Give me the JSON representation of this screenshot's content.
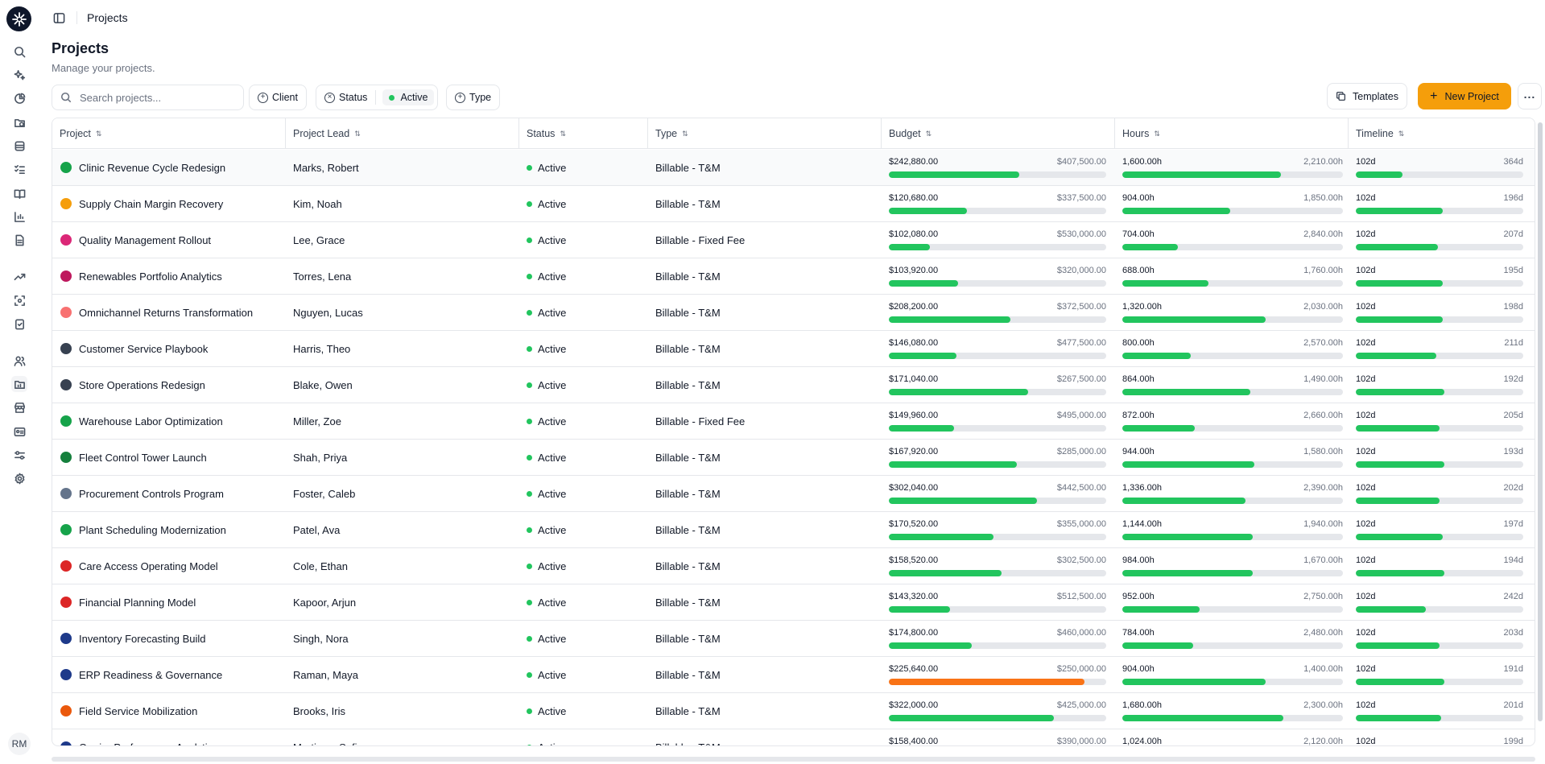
{
  "header": {
    "breadcrumb": "Projects"
  },
  "page": {
    "title": "Projects",
    "subtitle": "Manage your projects."
  },
  "toolbar": {
    "search_placeholder": "Search projects...",
    "client_label": "Client",
    "status_label": "Status",
    "status_value": "Active",
    "type_label": "Type",
    "templates_label": "Templates",
    "new_project_label": "New Project"
  },
  "user": {
    "initials": "RM"
  },
  "columns": {
    "project": "Project",
    "lead": "Project Lead",
    "status": "Status",
    "type": "Type",
    "budget": "Budget",
    "hours": "Hours",
    "timeline": "Timeline"
  },
  "rows": [
    {
      "name": "Clinic Revenue Cycle Redesign",
      "lead": "Marks, Robert",
      "status": "Active",
      "type": "Billable - T&M",
      "budget_used": "$242,880.00",
      "budget_total": "$407,500.00",
      "budget_pct": 60,
      "hours_used": "1,600.00h",
      "hours_total": "2,210.00h",
      "hours_pct": 72,
      "time_used": "102d",
      "time_total": "364d",
      "time_pct": 28,
      "icon_color": "#16a34a"
    },
    {
      "name": "Supply Chain Margin Recovery",
      "lead": "Kim, Noah",
      "status": "Active",
      "type": "Billable - T&M",
      "budget_used": "$120,680.00",
      "budget_total": "$337,500.00",
      "budget_pct": 36,
      "hours_used": "904.00h",
      "hours_total": "1,850.00h",
      "hours_pct": 49,
      "time_used": "102d",
      "time_total": "196d",
      "time_pct": 52,
      "icon_color": "#f59e0b"
    },
    {
      "name": "Quality Management Rollout",
      "lead": "Lee, Grace",
      "status": "Active",
      "type": "Billable - Fixed Fee",
      "budget_used": "$102,080.00",
      "budget_total": "$530,000.00",
      "budget_pct": 19,
      "hours_used": "704.00h",
      "hours_total": "2,840.00h",
      "hours_pct": 25,
      "time_used": "102d",
      "time_total": "207d",
      "time_pct": 49,
      "icon_color": "#db2777"
    },
    {
      "name": "Renewables Portfolio Analytics",
      "lead": "Torres, Lena",
      "status": "Active",
      "type": "Billable - T&M",
      "budget_used": "$103,920.00",
      "budget_total": "$320,000.00",
      "budget_pct": 32,
      "hours_used": "688.00h",
      "hours_total": "1,760.00h",
      "hours_pct": 39,
      "time_used": "102d",
      "time_total": "195d",
      "time_pct": 52,
      "icon_color": "#be185d"
    },
    {
      "name": "Omnichannel Returns Transformation",
      "lead": "Nguyen, Lucas",
      "status": "Active",
      "type": "Billable - T&M",
      "budget_used": "$208,200.00",
      "budget_total": "$372,500.00",
      "budget_pct": 56,
      "hours_used": "1,320.00h",
      "hours_total": "2,030.00h",
      "hours_pct": 65,
      "time_used": "102d",
      "time_total": "198d",
      "time_pct": 52,
      "icon_color": "#f87171"
    },
    {
      "name": "Customer Service Playbook",
      "lead": "Harris, Theo",
      "status": "Active",
      "type": "Billable - T&M",
      "budget_used": "$146,080.00",
      "budget_total": "$477,500.00",
      "budget_pct": 31,
      "hours_used": "800.00h",
      "hours_total": "2,570.00h",
      "hours_pct": 31,
      "time_used": "102d",
      "time_total": "211d",
      "time_pct": 48,
      "icon_color": "#374151"
    },
    {
      "name": "Store Operations Redesign",
      "lead": "Blake, Owen",
      "status": "Active",
      "type": "Billable - T&M",
      "budget_used": "$171,040.00",
      "budget_total": "$267,500.00",
      "budget_pct": 64,
      "hours_used": "864.00h",
      "hours_total": "1,490.00h",
      "hours_pct": 58,
      "time_used": "102d",
      "time_total": "192d",
      "time_pct": 53,
      "icon_color": "#374151"
    },
    {
      "name": "Warehouse Labor Optimization",
      "lead": "Miller, Zoe",
      "status": "Active",
      "type": "Billable - Fixed Fee",
      "budget_used": "$149,960.00",
      "budget_total": "$495,000.00",
      "budget_pct": 30,
      "hours_used": "872.00h",
      "hours_total": "2,660.00h",
      "hours_pct": 33,
      "time_used": "102d",
      "time_total": "205d",
      "time_pct": 50,
      "icon_color": "#16a34a"
    },
    {
      "name": "Fleet Control Tower Launch",
      "lead": "Shah, Priya",
      "status": "Active",
      "type": "Billable - T&M",
      "budget_used": "$167,920.00",
      "budget_total": "$285,000.00",
      "budget_pct": 59,
      "hours_used": "944.00h",
      "hours_total": "1,580.00h",
      "hours_pct": 60,
      "time_used": "102d",
      "time_total": "193d",
      "time_pct": 53,
      "icon_color": "#15803d"
    },
    {
      "name": "Procurement Controls Program",
      "lead": "Foster, Caleb",
      "status": "Active",
      "type": "Billable - T&M",
      "budget_used": "$302,040.00",
      "budget_total": "$442,500.00",
      "budget_pct": 68,
      "hours_used": "1,336.00h",
      "hours_total": "2,390.00h",
      "hours_pct": 56,
      "time_used": "102d",
      "time_total": "202d",
      "time_pct": 50,
      "icon_color": "#64748b"
    },
    {
      "name": "Plant Scheduling Modernization",
      "lead": "Patel, Ava",
      "status": "Active",
      "type": "Billable - T&M",
      "budget_used": "$170,520.00",
      "budget_total": "$355,000.00",
      "budget_pct": 48,
      "hours_used": "1,144.00h",
      "hours_total": "1,940.00h",
      "hours_pct": 59,
      "time_used": "102d",
      "time_total": "197d",
      "time_pct": 52,
      "icon_color": "#16a34a"
    },
    {
      "name": "Care Access Operating Model",
      "lead": "Cole, Ethan",
      "status": "Active",
      "type": "Billable - T&M",
      "budget_used": "$158,520.00",
      "budget_total": "$302,500.00",
      "budget_pct": 52,
      "hours_used": "984.00h",
      "hours_total": "1,670.00h",
      "hours_pct": 59,
      "time_used": "102d",
      "time_total": "194d",
      "time_pct": 53,
      "icon_color": "#dc2626"
    },
    {
      "name": "Financial Planning Model",
      "lead": "Kapoor, Arjun",
      "status": "Active",
      "type": "Billable - T&M",
      "budget_used": "$143,320.00",
      "budget_total": "$512,500.00",
      "budget_pct": 28,
      "hours_used": "952.00h",
      "hours_total": "2,750.00h",
      "hours_pct": 35,
      "time_used": "102d",
      "time_total": "242d",
      "time_pct": 42,
      "icon_color": "#dc2626"
    },
    {
      "name": "Inventory Forecasting Build",
      "lead": "Singh, Nora",
      "status": "Active",
      "type": "Billable - T&M",
      "budget_used": "$174,800.00",
      "budget_total": "$460,000.00",
      "budget_pct": 38,
      "hours_used": "784.00h",
      "hours_total": "2,480.00h",
      "hours_pct": 32,
      "time_used": "102d",
      "time_total": "203d",
      "time_pct": 50,
      "icon_color": "#1e3a8a"
    },
    {
      "name": "ERP Readiness & Governance",
      "lead": "Raman, Maya",
      "status": "Active",
      "type": "Billable - T&M",
      "budget_used": "$225,640.00",
      "budget_total": "$250,000.00",
      "budget_pct": 90,
      "over": true,
      "hours_used": "904.00h",
      "hours_total": "1,400.00h",
      "hours_pct": 65,
      "time_used": "102d",
      "time_total": "191d",
      "time_pct": 53,
      "icon_color": "#1e3a8a"
    },
    {
      "name": "Field Service Mobilization",
      "lead": "Brooks, Iris",
      "status": "Active",
      "type": "Billable - T&M",
      "budget_used": "$322,000.00",
      "budget_total": "$425,000.00",
      "budget_pct": 76,
      "hours_used": "1,680.00h",
      "hours_total": "2,300.00h",
      "hours_pct": 73,
      "time_used": "102d",
      "time_total": "201d",
      "time_pct": 51,
      "icon_color": "#ea580c"
    },
    {
      "name": "Carrier Performance Analytics",
      "lead": "Martinez, Sofia",
      "status": "Active",
      "type": "Billable - T&M",
      "budget_used": "$158,400.00",
      "budget_total": "$390,000.00",
      "budget_pct": 41,
      "hours_used": "1,024.00h",
      "hours_total": "2,120.00h",
      "hours_pct": 48,
      "time_used": "102d",
      "time_total": "199d",
      "time_pct": 51,
      "icon_color": "#1e3a8a"
    }
  ]
}
